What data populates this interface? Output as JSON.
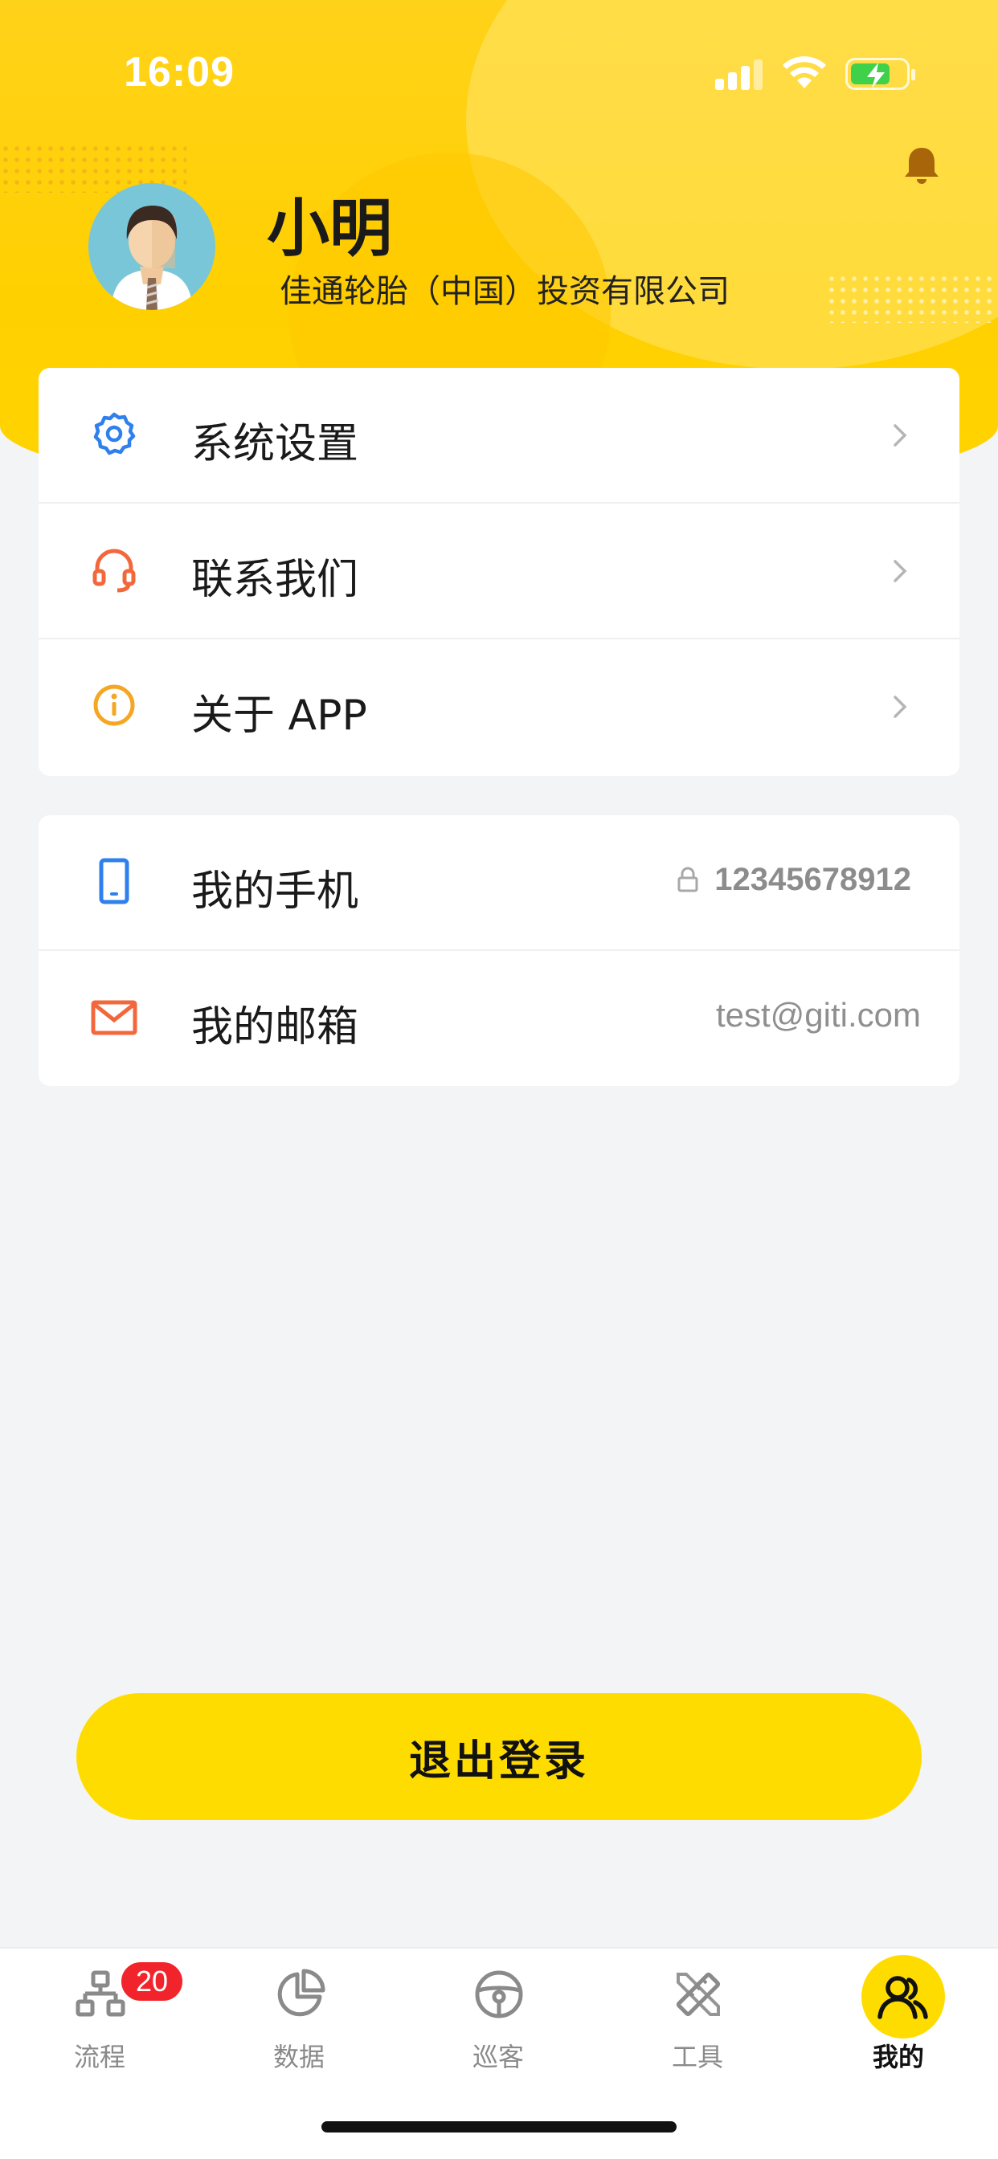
{
  "status_bar": {
    "time": "16:09"
  },
  "profile": {
    "name": "小明",
    "company": "佳通轮胎（中国）投资有限公司"
  },
  "menu_card": {
    "items": [
      {
        "label": "系统设置",
        "icon": "gear-icon",
        "color": "#2f80ed"
      },
      {
        "label": "联系我们",
        "icon": "headset-icon",
        "color": "#f2683c"
      },
      {
        "label": "关于 APP",
        "icon": "info-icon",
        "color": "#f5a623"
      }
    ]
  },
  "contact_card": {
    "phone": {
      "label": "我的手机",
      "value": "12345678912",
      "icon": "phone-icon"
    },
    "email": {
      "label": "我的邮箱",
      "value": "test@giti.com",
      "icon": "mail-icon"
    }
  },
  "logout": {
    "label": "退出登录"
  },
  "tabbar": {
    "tabs": [
      {
        "label": "流程",
        "icon": "flow-icon",
        "badge": "20"
      },
      {
        "label": "数据",
        "icon": "pie-chart-icon"
      },
      {
        "label": "巡客",
        "icon": "steering-wheel-icon"
      },
      {
        "label": "工具",
        "icon": "ruler-pencil-icon"
      },
      {
        "label": "我的",
        "icon": "users-icon",
        "active": true
      }
    ]
  },
  "colors": {
    "brand_yellow": "#ffdc00",
    "badge_red": "#f2242b",
    "background": "#f3f4f6"
  }
}
